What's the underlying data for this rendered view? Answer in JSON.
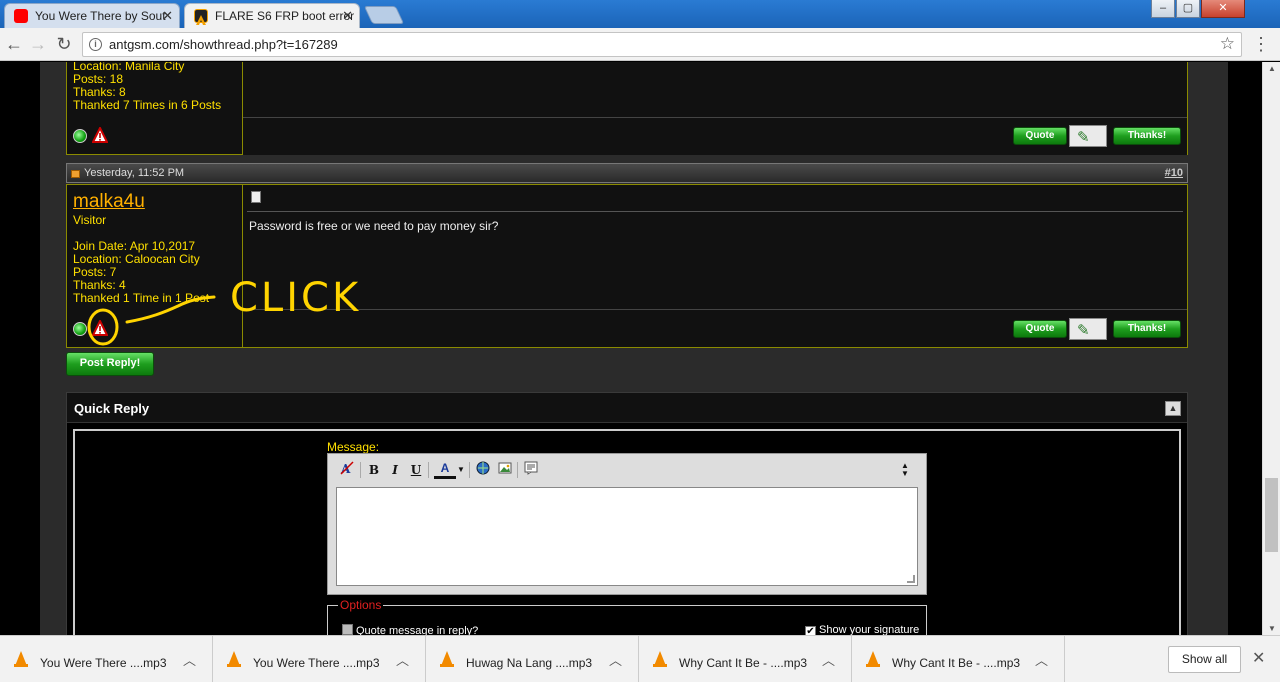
{
  "browser": {
    "tabs": [
      {
        "title": "You Were There by Sout",
        "favicon": "youtube-icon",
        "favicon_color": "#ff0000"
      },
      {
        "title": "FLARE S6 FRP boot error",
        "favicon": "antgsm-icon",
        "favicon_color": "#f3a000"
      }
    ],
    "url": "antgsm.com/showthread.php?t=167289",
    "window_controls": {
      "minimize": "‒",
      "maximize": "▢",
      "close": "✕"
    }
  },
  "previous_post": {
    "stats": [
      "Location: Manila City",
      "Posts: 18",
      "Thanks: 8",
      "Thanked 7 Times in 6 Posts"
    ],
    "quote_label": "Quote",
    "thanks_label": "Thanks!"
  },
  "post": {
    "date": "Yesterday, 11:52 PM",
    "number": "#10",
    "username": "malka4u",
    "user_title": "Visitor",
    "stats": [
      "Join Date: Apr 10,2017",
      "Location: Caloocan City",
      "Posts: 7",
      "Thanks: 4",
      "Thanked 1 Time in 1 Post"
    ],
    "message": "Password is free or we need to pay money sir?",
    "quote_label": "Quote",
    "thanks_label": "Thanks!"
  },
  "post_reply_label": "Post Reply!",
  "quick_reply": {
    "title": "Quick Reply",
    "message_label": "Message:",
    "toolbar": {
      "bold": "B",
      "italic": "I",
      "underline": "U",
      "font_color": "A"
    },
    "options_label": "Options",
    "quote_option": "Quote message in reply?",
    "signature_option": "Show your signature",
    "signature_checked": true
  },
  "annotation_text": "CLICK",
  "downloads": [
    {
      "name": "You Were There ....mp3"
    },
    {
      "name": "You Were There ....mp3"
    },
    {
      "name": "Huwag Na Lang ....mp3"
    },
    {
      "name": "Why Cant It Be - ....mp3"
    },
    {
      "name": "Why Cant It Be - ....mp3"
    }
  ],
  "show_all_label": "Show all",
  "colors": {
    "user_info": "#ffe000",
    "username": "#ffb000",
    "border": "#8b8b00",
    "button_green": "#1e9e1e",
    "annotation": "#ffd400"
  }
}
